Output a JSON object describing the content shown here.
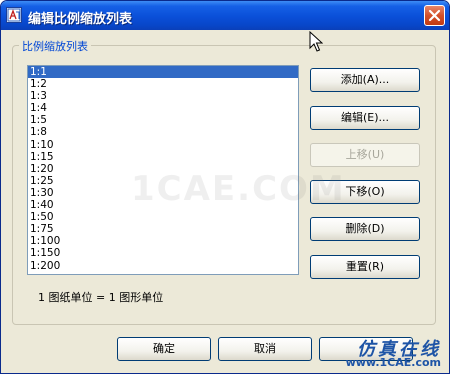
{
  "window": {
    "title": "编辑比例缩放列表"
  },
  "group": {
    "label": "比例缩放列表"
  },
  "scale_list": {
    "items": [
      "1:1",
      "1:2",
      "1:3",
      "1:4",
      "1:5",
      "1:8",
      "1:10",
      "1:15",
      "1:20",
      "1:25",
      "1:30",
      "1:40",
      "1:50",
      "1:75",
      "1:100",
      "1:150",
      "1:200"
    ],
    "selected": "1:1"
  },
  "buttons": {
    "add": "添加(A)...",
    "edit": "编辑(E)...",
    "move_up": "上移(U)",
    "move_down": "下移(O)",
    "delete": "删除(D)",
    "reset": "重置(R)",
    "ok": "确定",
    "cancel": "取消"
  },
  "footnote": "1 图纸单位 = 1 图形单位",
  "watermark": "1CAE.COM",
  "site_logo": {
    "text": "仿真在线",
    "url": "www.1CAE.com"
  },
  "colors": {
    "title_bar": "#0a4fd8",
    "selection": "#316ac5",
    "group_label": "#0046d5"
  }
}
